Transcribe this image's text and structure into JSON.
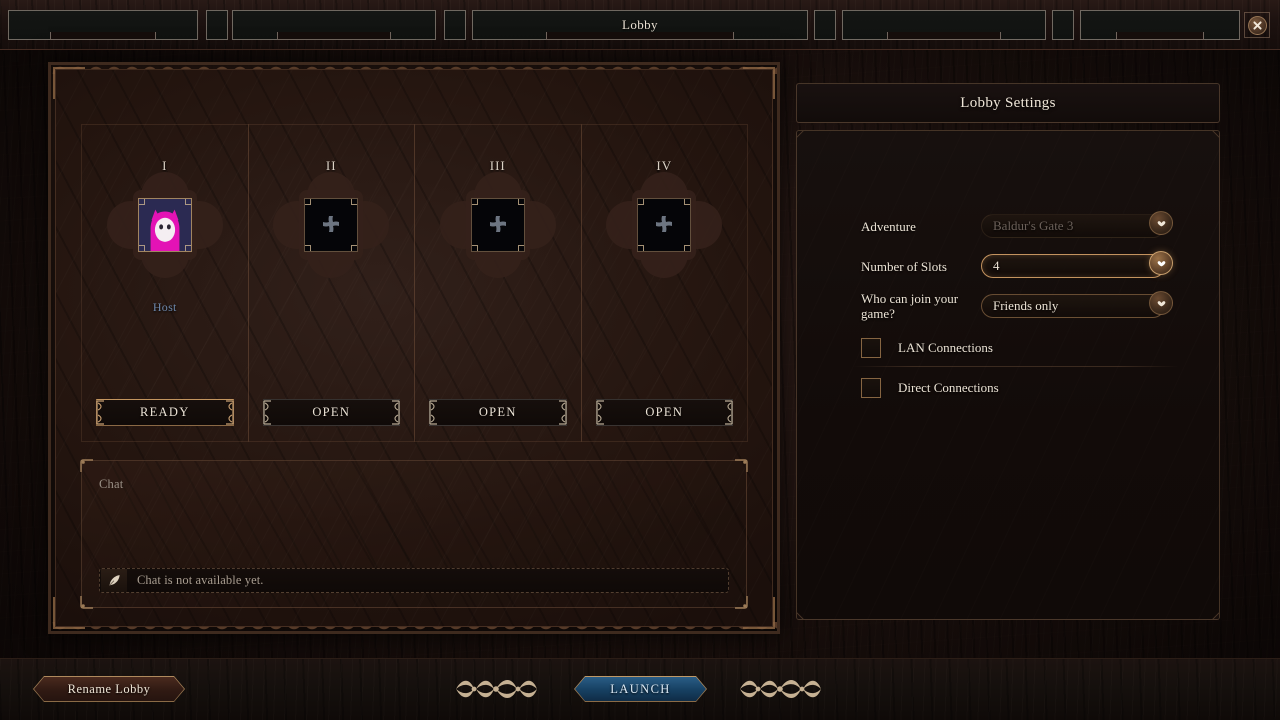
{
  "window": {
    "title": "Lobby",
    "close_icon": "close-x-icon",
    "tabs": [
      "",
      "",
      "",
      "",
      "",
      "",
      "",
      ""
    ]
  },
  "slots": [
    {
      "numeral": "I",
      "status_label": "Host",
      "button_label": "READY",
      "occupied": true,
      "avatar": "pink-hooded-cat-avatar",
      "avatar_colors": {
        "background": "#2b2a52",
        "hood": "#e313b5",
        "face": "#f4eef2",
        "eye": "#2a2533"
      }
    },
    {
      "numeral": "II",
      "status_label": "",
      "button_label": "OPEN",
      "occupied": false,
      "avatar": "empty-slot-cross-icon"
    },
    {
      "numeral": "III",
      "status_label": "",
      "button_label": "OPEN",
      "occupied": false,
      "avatar": "empty-slot-cross-icon"
    },
    {
      "numeral": "IV",
      "status_label": "",
      "button_label": "OPEN",
      "occupied": false,
      "avatar": "empty-slot-cross-icon"
    }
  ],
  "chat": {
    "title": "Chat",
    "input_placeholder": "Chat is not available yet.",
    "input_icon": "quill-icon",
    "messages": []
  },
  "settings": {
    "header": "Lobby Settings",
    "fields": [
      {
        "label": "Adventure",
        "value": "Baldur's Gate 3",
        "disabled": true,
        "highlighted": false,
        "chevron_icon": "chevron-down-icon"
      },
      {
        "label": "Number of Slots",
        "value": "4",
        "disabled": false,
        "highlighted": true,
        "chevron_icon": "chevron-down-icon"
      },
      {
        "label": "Who can join your game?",
        "value": "Friends only",
        "disabled": false,
        "highlighted": false,
        "chevron_icon": "chevron-down-icon"
      }
    ],
    "checkboxes": [
      {
        "label": "LAN Connections",
        "checked": false
      },
      {
        "label": "Direct Connections",
        "checked": false
      }
    ]
  },
  "footer": {
    "rename_label": "Rename Lobby",
    "launch_label": "LAUNCH"
  },
  "colors": {
    "accent_bronze": "#b08b5e",
    "launch_blue": "#2a5d86",
    "host_blue": "#6e89ad",
    "text_cream": "#ece3d5",
    "panel_dark": "#1b0f0b"
  }
}
